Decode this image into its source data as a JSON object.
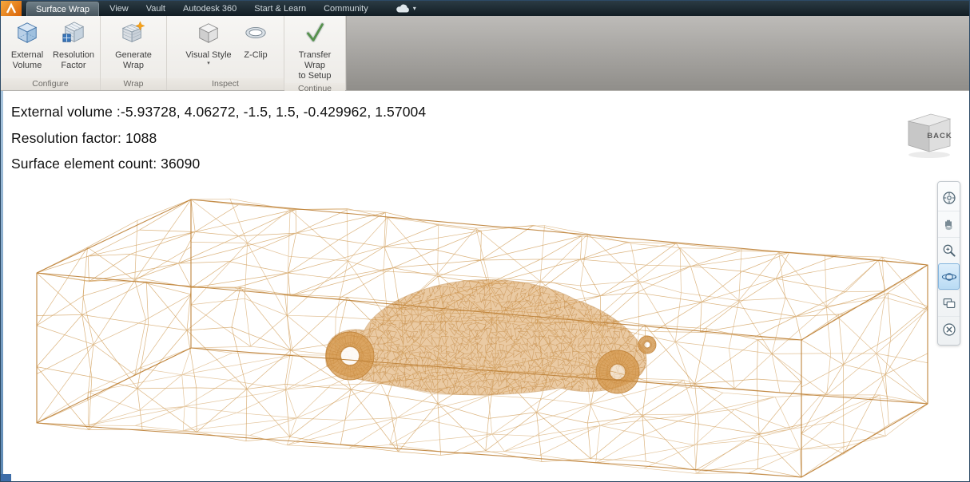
{
  "tabs": [
    {
      "label": "Surface Wrap",
      "active": true
    },
    {
      "label": "View"
    },
    {
      "label": "Vault"
    },
    {
      "label": "Autodesk 360"
    },
    {
      "label": "Start & Learn"
    },
    {
      "label": "Community"
    }
  ],
  "ribbon": {
    "groups": [
      {
        "label": "Configure",
        "buttons": [
          {
            "line1": "External",
            "line2": "Volume"
          },
          {
            "line1": "Resolution",
            "line2": "Factor"
          }
        ]
      },
      {
        "label": "Wrap",
        "buttons": [
          {
            "line1": "Generate Wrap",
            "line2": ""
          }
        ]
      },
      {
        "label": "Inspect",
        "buttons": [
          {
            "line1": "Visual Style",
            "line2": "",
            "dropdown": true
          },
          {
            "line1": "Z-Clip",
            "line2": ""
          }
        ]
      },
      {
        "label": "Continue",
        "buttons": [
          {
            "line1": "Transfer Wrap",
            "line2": "to Setup"
          }
        ]
      }
    ]
  },
  "status": {
    "line1": "External volume :-5.93728, 4.06272, -1.5, 1.5, -0.429962, 1.57004",
    "line2": "Resolution factor: 1088",
    "line3": "Surface element count: 36090"
  },
  "values": {
    "external_volume": [
      -5.93728,
      4.06272,
      -1.5,
      1.5,
      -0.429962,
      1.57004
    ],
    "resolution_factor": 1088,
    "surface_element_count": 36090
  },
  "viewcube": {
    "face_label": "BACK"
  },
  "nav_toolbar": {
    "icons": [
      "navigation-wheel",
      "pan",
      "zoom",
      "orbit",
      "showmotion",
      "close"
    ],
    "active": "orbit"
  },
  "scene": {
    "mesh_color": "#d2a express05e",
    "mesh_color_fix": "#d2a05e",
    "mesh_dark": "#bd7f35",
    "car_fill": "#d6974a",
    "background": "#ffffff"
  },
  "colors": {
    "tabbar_bg": "#1b262d",
    "ribbon_bg": "#f1efec",
    "accent_orange": "#e87817",
    "nav_active_border": "#84b5de",
    "frame_blue": "#5d89b4"
  }
}
